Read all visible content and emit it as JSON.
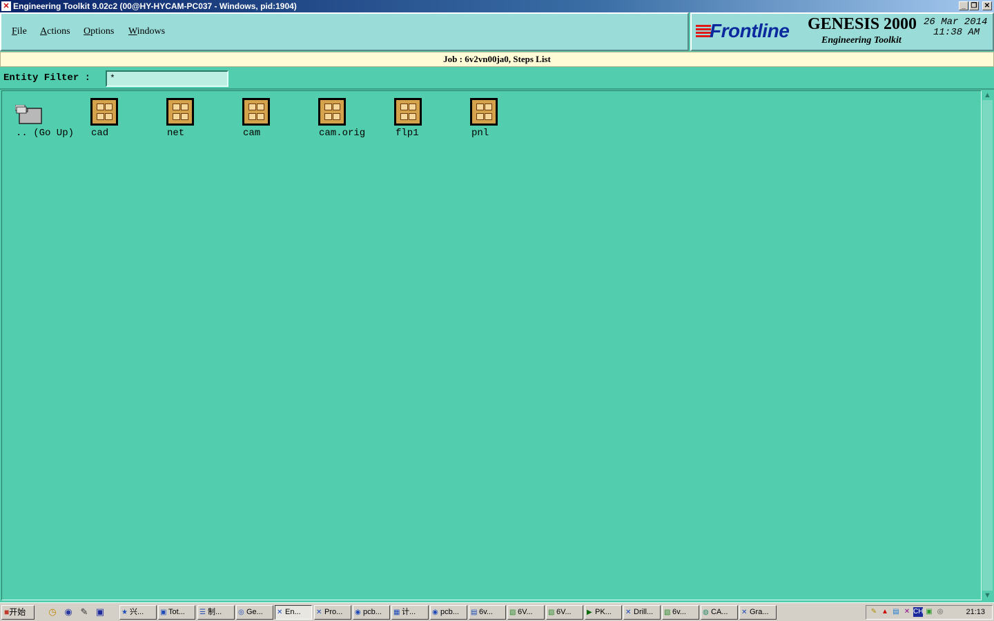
{
  "window": {
    "title": "Engineering Toolkit 9.02c2 (00@HY-HYCAM-PC037 - Windows, pid:1904)",
    "buttons": [
      "_",
      "❐",
      "✕"
    ]
  },
  "menu": [
    {
      "label": "File",
      "mnemonic": "F",
      "rest": "ile"
    },
    {
      "label": "Actions",
      "mnemonic": "A",
      "rest": "ctions"
    },
    {
      "label": "Options",
      "mnemonic": "O",
      "rest": "ptions"
    },
    {
      "label": "Windows",
      "mnemonic": "W",
      "rest": "indows"
    }
  ],
  "brand": {
    "logo": "Frontline",
    "product": "GENESIS 2000",
    "subtitle": "Engineering Toolkit",
    "date": "26 Mar 2014",
    "time": "11:38 AM"
  },
  "job_bar": "Job : 6v2vn00ja0, Steps List",
  "filter": {
    "label": "Entity Filter :",
    "value": "*"
  },
  "go_up": {
    "label": ".. (Go Up)"
  },
  "steps": [
    {
      "label": "cad"
    },
    {
      "label": "net"
    },
    {
      "label": "cam"
    },
    {
      "label": "cam.orig"
    },
    {
      "label": "flp1"
    },
    {
      "label": "pnl"
    }
  ],
  "taskbar": {
    "start": "开始",
    "tasks": [
      "兴...",
      "Tot...",
      "制...",
      "Ge...",
      "En...",
      "Pro...",
      "pcb...",
      "计...",
      "pcb...",
      "6v...",
      "6V...",
      "6V...",
      "PK...",
      "Drill...",
      "6v...",
      "CA...",
      "Gra..."
    ],
    "active_task": "En...",
    "tray_lang": "CH",
    "clock": "21:13"
  }
}
